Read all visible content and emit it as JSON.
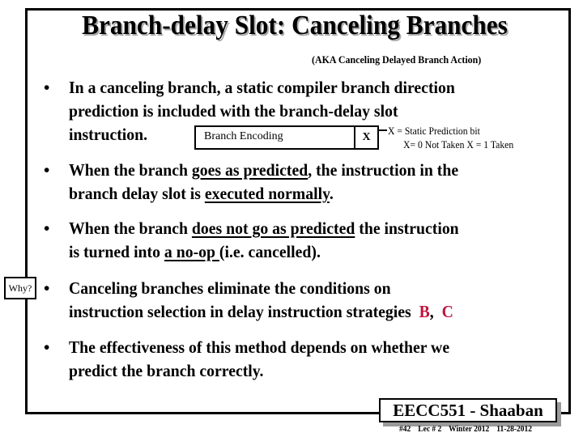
{
  "slide": {
    "title": "Branch-delay Slot: Canceling Branches",
    "subtitle": "(AKA Canceling Delayed Branch Action)",
    "bullet_char": "•",
    "bullets": [
      {
        "line1": "In a canceling branch, a static compiler branch direction",
        "line2": "prediction is included with the branch-delay slot",
        "line3": "instruction."
      },
      {
        "line1_pre": "When the branch ",
        "line1_u": "goes as predicted",
        "line1_post": ", the instruction in the",
        "line2_pre": "branch delay slot is ",
        "line2_u": "executed normally",
        "line2_post": "."
      },
      {
        "line1_pre": "When the branch ",
        "line1_u": "does not go as predicted",
        "line1_post": " the instruction",
        "line2_pre": "is turned into ",
        "line2_u": "a no-op ",
        "line2_post": "(i.e. cancelled)."
      },
      {
        "line1": "Canceling branches eliminate the conditions on",
        "line2_pre": "instruction selection in delay instruction strategies  ",
        "strategy_b": "B",
        "sep": ",  ",
        "strategy_c": "C"
      },
      {
        "line1": "The effectiveness of this method depends on whether we",
        "line2": "predict the branch correctly."
      }
    ],
    "encoding_diagram": {
      "field_label": "Branch Encoding",
      "bit_label": "X",
      "note_line1": "X = Static Prediction bit",
      "note_line2": "X= 0  Not Taken    X = 1  Taken"
    },
    "why_label": "Why?",
    "badge": "EECC551 - Shaaban",
    "footer": {
      "slide_number": "#42",
      "lecture": "Lec # 2",
      "term": "Winter 2012",
      "date": "11-28-2012"
    },
    "colors": {
      "accent_red": "#c0143c",
      "shadow_gray": "#9a9a9a"
    }
  }
}
